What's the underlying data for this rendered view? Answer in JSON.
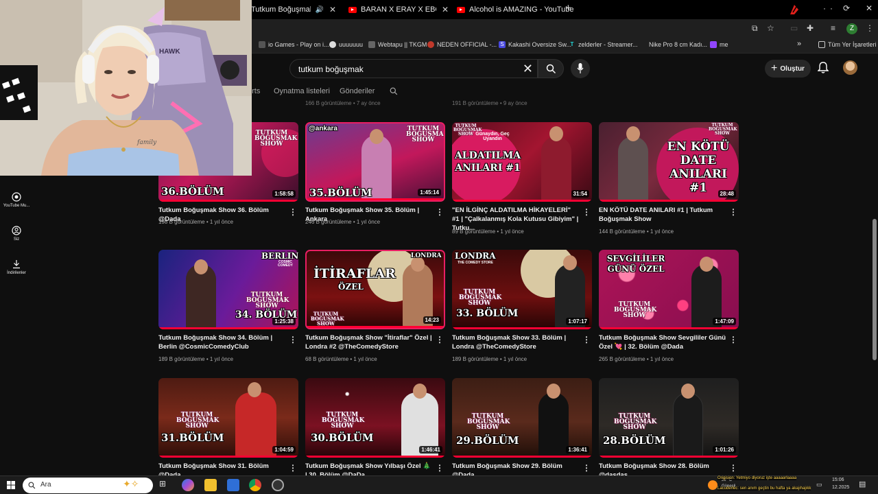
{
  "browser": {
    "tabs": [
      {
        "title": "Tutkum Boğuşmak Show 3·"
      },
      {
        "title": "BARAN X ERAY X EBONİVON X"
      },
      {
        "title": "Alcohol is AMAZING - YouTube"
      }
    ],
    "new_tab": "+",
    "window_controls": [
      "·",
      "·"
    ],
    "profile_initial": "Z",
    "bookmarks": [
      "io Games - Play on i...",
      "uuuuuuu",
      "Webtapu || TKGM",
      "NEDEN OFFICIAL -...",
      "Kakashi Oversize Sw...",
      "zelderler - Streamer...",
      "Nike Pro 8 cm Kadı...",
      "me"
    ],
    "bookmarks_more": "»",
    "all_bookmarks": "Tüm Yer İşaretleri"
  },
  "youtube": {
    "search_query": "tutkum boğuşmak",
    "create_label": "Oluştur",
    "chips": [
      "orts",
      "Oynatma listeleri",
      "Gönderiler"
    ],
    "faint_meta": [
      "166 B görüntüleme • 7 ay önce",
      "191 B görüntüleme • 9 ay önce"
    ],
    "sidebar": [
      {
        "label": "YouTube Mu...",
        "icon": "youtube-music-icon"
      },
      {
        "label": "Siz",
        "icon": "account-icon"
      },
      {
        "label": "İndirilenler",
        "icon": "download-icon"
      }
    ],
    "videos": [
      {
        "title": "Tutkum Boğuşmak Show 36. Bölüm @Dada",
        "meta": "198 B görüntüleme • 1 yıl önce",
        "duration": "1:58:58",
        "thumb_label": "36.BÖLÜM",
        "show_text": "TUTKUM BOĞUŞMAK SHOW"
      },
      {
        "title": "Tutkum Boğuşmak Show 35. Bölüm | Ankara",
        "meta": "246 B görüntüleme • 1 yıl önce",
        "duration": "1:45:14",
        "thumb_label": "35.BÖLÜM",
        "thumb_tag": "@ankara",
        "show_text": "TUTKUM BOĞUŞMAK SHOW"
      },
      {
        "title": "\"EN İLGİNÇ ALDATILMA HİKAYELERİ\" #1 | \"Çalkalanmış Kola Kutusu Gibiyim\" | Tutku...",
        "meta": "89 B görüntüleme • 1 yıl önce",
        "duration": "31:54",
        "thumb_label": "ALDATILMA ANILARI #1",
        "thumb_tag": "Günaydın, Geç Uyandın",
        "show_text": "TUTKUM BOĞUŞMAK SHOW"
      },
      {
        "title": "EN KÖTÜ DATE ANILARI #1 | Tutkum Boğuşmak Show",
        "meta": "144 B görüntüleme • 1 yıl önce",
        "duration": "28:48",
        "thumb_label": "EN KÖTÜ DATE ANILARI #1",
        "show_text": "TUTKUM BOĞUŞMAK SHOW"
      },
      {
        "title": "Tutkum Boğuşmak Show 34. Bölüm | Berlin @CosmicComedyClub",
        "meta": "189 B görüntüleme • 1 yıl önce",
        "duration": "1:25:38",
        "thumb_label": "34. BÖLÜM",
        "thumb_tag": "BERLIN",
        "thumb_sub": "COSMIC COMEDY",
        "show_text": "TUTKUM BOĞUŞMAK SHOW"
      },
      {
        "title": "Tutkum Boğuşmak Show \"İtiraflar\" Özel | Londra #2 @TheComedyStore",
        "meta": "68 B görüntüleme • 1 yıl önce",
        "duration": "14:23",
        "thumb_label": "İTİRAFLAR",
        "thumb_sub": "ÖZEL",
        "thumb_tag": "LONDRA",
        "show_text": "TUTKUM BOĞUŞMAK SHOW"
      },
      {
        "title": "Tutkum Boğuşmak Show 33. Bölüm | Londra @TheComedyStore",
        "meta": "189 B görüntüleme • 1 yıl önce",
        "duration": "1:07:17",
        "thumb_label": "33. BÖLÜM",
        "thumb_tag": "LONDRA",
        "thumb_sub": "THE COMEDY STORE",
        "show_text": "TUTKUM BOĞUŞMAK SHOW"
      },
      {
        "title": "Tutkum Boğuşmak Show Sevgililer Günü Özel 💘 | 32. Bölüm @Dada",
        "meta": "265 B görüntüleme • 1 yıl önce",
        "duration": "1:47:09",
        "thumb_label": "SEVGİLİLER GÜNÜ ÖZEL",
        "show_text": "TUTKUM BOĞUŞMAK SHOW"
      },
      {
        "title": "Tutkum Boğuşmak Show 31. Bölüm @Dada",
        "meta": "",
        "duration": "1:04:59",
        "thumb_label": "31.BÖLÜM",
        "show_text": "TUTKUM BOĞUŞMAK SHOW"
      },
      {
        "title": "Tutkum Boğuşmak Show Yılbaşı Özel 🎄 | 30. Bölüm @DaDa",
        "meta": "",
        "duration": "1:46:41",
        "thumb_label": "30.BÖLÜM",
        "show_text": "TUTKUM BOĞUŞMAK SHOW"
      },
      {
        "title": "Tutkum Boğuşmak Show 29. Bölüm @Dada",
        "meta": "",
        "duration": "1:36:41",
        "thumb_label": "29.BÖLÜM",
        "show_text": "TUTKUM BOĞUŞMAK SHOW"
      },
      {
        "title": "Tutkum Boğuşmak Show 28. Bölüm @dasdas",
        "meta": "",
        "duration": "1:01:26",
        "thumb_label": "28.BÖLÜM",
        "show_text": "TUTKUM BOĞUŞMAK SHOW"
      }
    ]
  },
  "webcam": {
    "chair_brand": "HAWK",
    "tattoo_text": "family"
  },
  "taskbar": {
    "search_placeholder": "Ara",
    "weather_temp": "29 °C",
    "weather_text": "Güneşli",
    "notification_1": "Origision: Yetmiyo diyoruz işte aaaaarlaaaa",
    "notification_2": "Lacuderlec: sen anım geçtin bu hafta ya akajıhajıkk",
    "time": "15:06",
    "date": "12.2025"
  },
  "colors": {
    "background": "#0f0f0f",
    "accent_red": "#ff0033",
    "thumb_pink": "#c2185b"
  }
}
